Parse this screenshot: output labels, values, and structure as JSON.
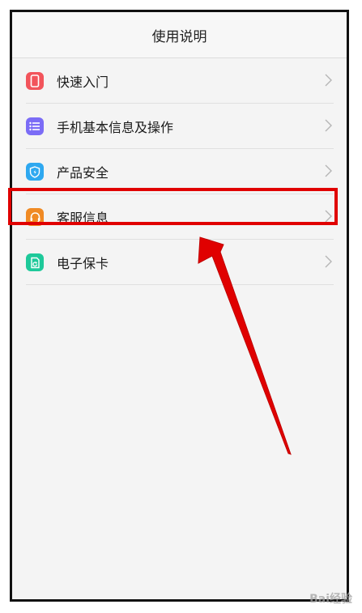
{
  "header": {
    "title": "使用说明"
  },
  "menu": {
    "items": [
      {
        "label": "快速入门",
        "icon": "phone-icon",
        "color": "#f2545b"
      },
      {
        "label": "手机基本信息及操作",
        "icon": "list-icon",
        "color": "#7b6cf6"
      },
      {
        "label": "产品安全",
        "icon": "shield-icon",
        "color": "#2ea8f0"
      },
      {
        "label": "客服信息",
        "icon": "headset-icon",
        "color": "#f08a24"
      },
      {
        "label": "电子保卡",
        "icon": "warranty-card-icon",
        "color": "#1ec99a"
      }
    ]
  },
  "annotation": {
    "highlight_color": "#e00000",
    "arrow_color": "#e00000"
  },
  "watermark": {
    "text": "Bai经验"
  }
}
